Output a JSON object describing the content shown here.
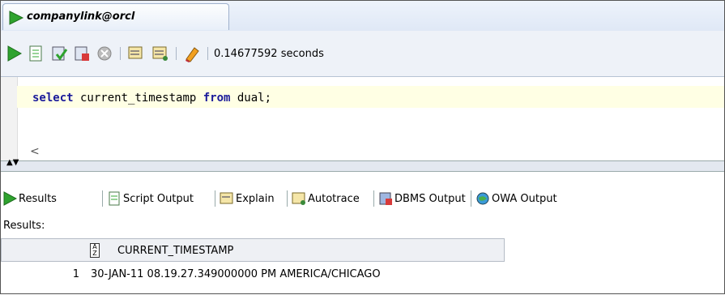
{
  "connection_tab": {
    "title": "companylink@orcl",
    "icon": "run-icon"
  },
  "toolbar": {
    "buttons": [
      "run-statement-icon",
      "run-script-icon",
      "commit-icon",
      "rollback-icon",
      "cancel-icon",
      "sql-tuning-icon",
      "autotrace-icon",
      "clear-icon"
    ],
    "timing": "0.14677592 seconds"
  },
  "editor": {
    "keyword1": "select",
    "ident1": " current_timestamp ",
    "keyword2": "from",
    "ident2": " dual;"
  },
  "output_tabs": [
    {
      "label": "Results",
      "icon": "play-icon"
    },
    {
      "label": "Script Output",
      "icon": "script-output-icon"
    },
    {
      "label": "Explain",
      "icon": "explain-icon"
    },
    {
      "label": "Autotrace",
      "icon": "autotrace-icon"
    },
    {
      "label": "DBMS Output",
      "icon": "dbms-output-icon"
    },
    {
      "label": "OWA Output",
      "icon": "owa-output-icon"
    }
  ],
  "results_label": "Results:",
  "grid": {
    "column": "CURRENT_TIMESTAMP",
    "rows": [
      {
        "num": "1",
        "value": "30-JAN-11 08.19.27.349000000 PM AMERICA/CHICAGO"
      }
    ]
  },
  "colors": {
    "run_green": "#2ea32e",
    "code_highlight": "#ffffe4",
    "keyword": "#1a1a9a"
  }
}
